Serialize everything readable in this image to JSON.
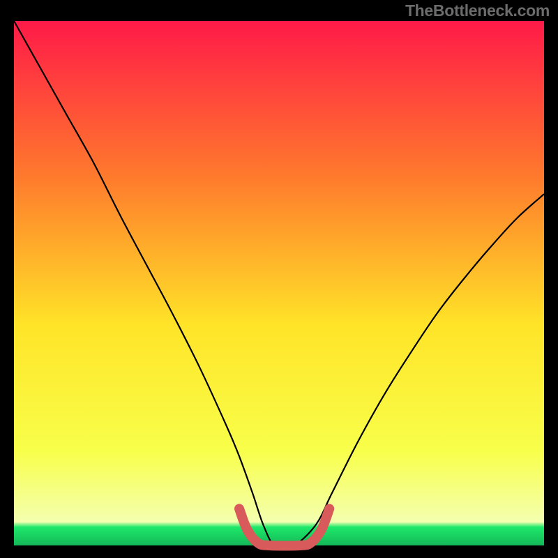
{
  "watermark": "TheBottleneck.com",
  "chart_data": {
    "type": "line",
    "title": "",
    "xlabel": "",
    "ylabel": "",
    "xlim": [
      0,
      100
    ],
    "ylim": [
      0,
      100
    ],
    "gradient_colors": {
      "top": "#ff1a48",
      "upper_mid": "#ff7b2c",
      "mid": "#ffe428",
      "lower_mid": "#f8ff4a",
      "bottom_band": "#1ee86a"
    },
    "series": [
      {
        "name": "bottleneck-curve",
        "color": "#000000",
        "x": [
          0,
          5,
          10,
          15,
          20,
          25,
          30,
          35,
          40,
          42.5,
          45,
          47,
          49,
          51,
          53,
          57,
          60,
          65,
          70,
          75,
          80,
          85,
          90,
          95,
          100
        ],
        "y": [
          100,
          91,
          82,
          73,
          63,
          53.5,
          44,
          34,
          23,
          17,
          10,
          4,
          0,
          0,
          0,
          4,
          10,
          20,
          29,
          37,
          44.5,
          51,
          57,
          62.5,
          67
        ]
      },
      {
        "name": "flat-minimum-highlight",
        "color": "#d85a5a",
        "stroke_width": 14,
        "x": [
          42.5,
          44,
          46,
          48,
          54,
          56,
          58,
          59.5
        ],
        "y": [
          7,
          3,
          0.5,
          0,
          0,
          0.5,
          3,
          7
        ]
      }
    ]
  }
}
